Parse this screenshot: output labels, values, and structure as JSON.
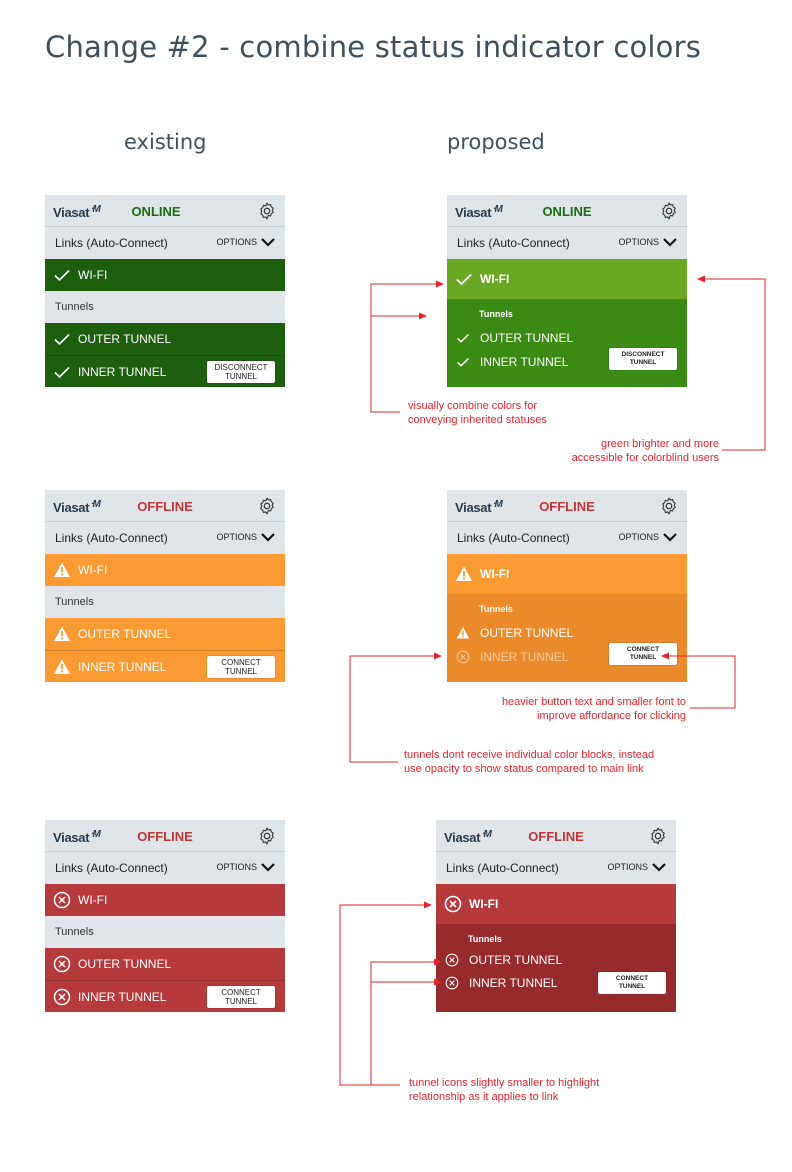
{
  "page_title": "Change #2 - combine status indicator colors",
  "columns": {
    "existing": "existing",
    "proposed": "proposed"
  },
  "common": {
    "logo": "Viasat",
    "links_label": "Links (Auto-Connect)",
    "options_label": "OPTIONS",
    "tunnels_label": "Tunnels",
    "wifi_label": "WI-FI",
    "outer_label": "OUTER TUNNEL",
    "inner_label": "INNER TUNNEL"
  },
  "panels": {
    "existing_online": {
      "status": "ONLINE",
      "button": [
        "DISCONNECT",
        "TUNNEL"
      ]
    },
    "proposed_online": {
      "status": "ONLINE",
      "button": [
        "DISCONNECT",
        "TUNNEL"
      ]
    },
    "existing_warn": {
      "status": "OFFLINE",
      "button": [
        "CONNECT",
        "TUNNEL"
      ]
    },
    "proposed_warn": {
      "status": "OFFLINE",
      "button": [
        "CONNECT",
        "TUNNEL"
      ]
    },
    "existing_error": {
      "status": "OFFLINE",
      "button": [
        "CONNECT",
        "TUNNEL"
      ]
    },
    "proposed_error": {
      "status": "OFFLINE",
      "button": [
        "CONNECT",
        "TUNNEL"
      ]
    }
  },
  "notes": {
    "combine": [
      "visually combine colors for",
      "conveying inherited statuses"
    ],
    "green": [
      "green brighter and more",
      "accessible for colorblind users"
    ],
    "button": [
      "heavier button text and smaller font to",
      "improve affordance for clicking"
    ],
    "opacity": [
      "tunnels dont receive individual color blocks, instead",
      "use opacity to show status compared to main link"
    ],
    "icons": [
      "tunnel icons slightly smaller to highlight",
      "relationship as it applies to link"
    ]
  },
  "colors": {
    "dark_green": "#1e5f0f",
    "bright_green": "#6aa722",
    "sub_green": "#3b8a14",
    "orange": "#f99a33",
    "sub_orange": "#ea8a2a",
    "red": "#b63a3b",
    "sub_red": "#962a2c",
    "annotation_red": "#e4232b"
  }
}
